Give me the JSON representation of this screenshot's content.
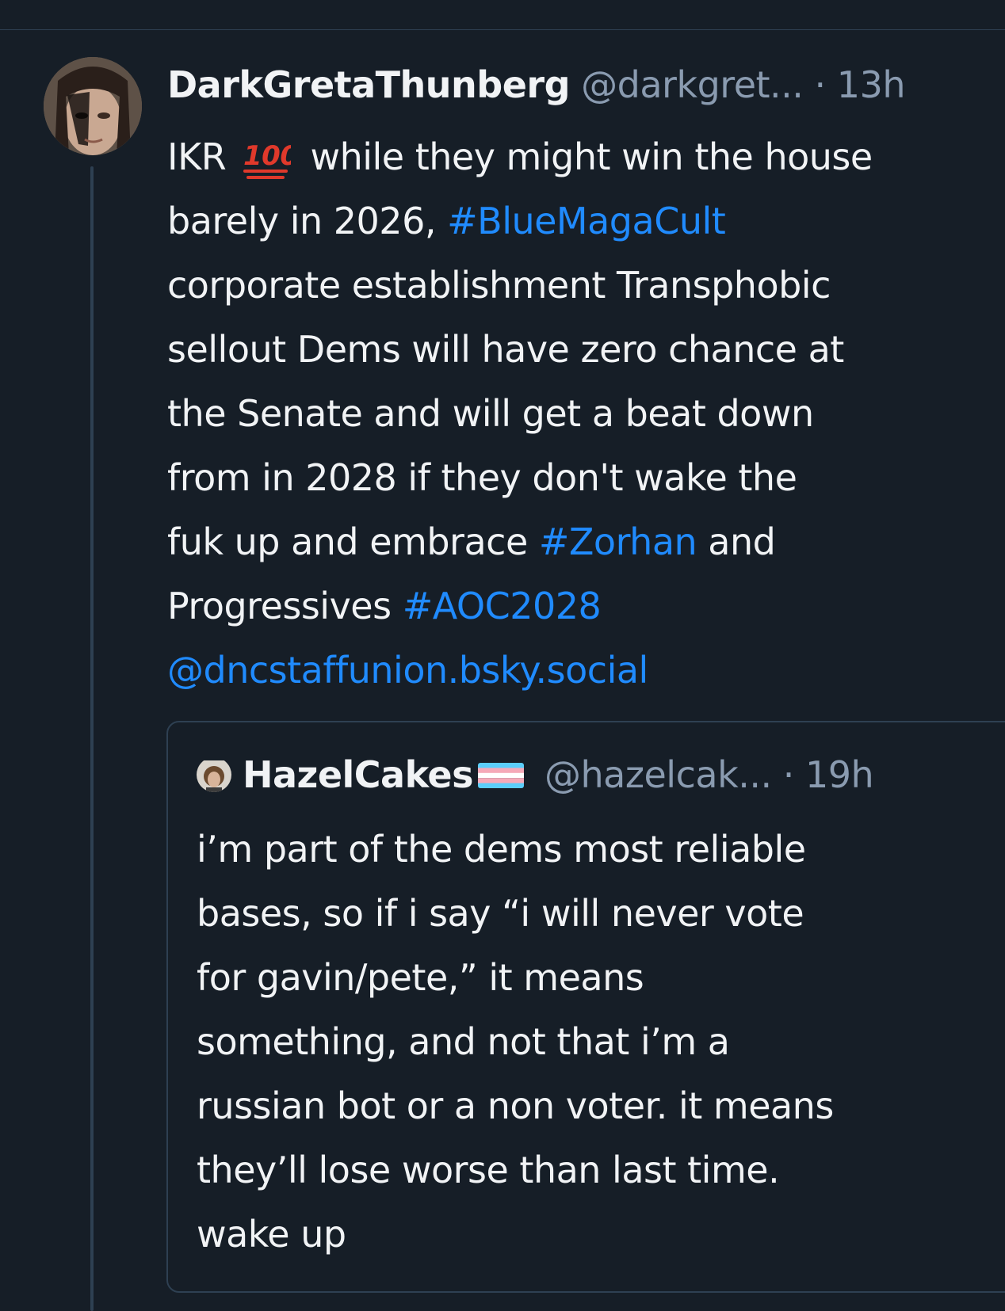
{
  "post": {
    "display_name": "DarkGretaThunberg",
    "handle": "@darkgret...",
    "separator": " · ",
    "timestamp": "13h",
    "avatar_icon": "user-avatar-photo",
    "emoji": "100-emoji",
    "body": {
      "l1a": "IKR",
      "l1b": "while they might win the house",
      "l2a": "barely in 2026, ",
      "l2b": "#BlueMagaCult",
      "l3": "corporate establishment Transphobic",
      "l4": "sellout Dems will have zero chance at",
      "l5": "the Senate and will get a beat down",
      "l6": "from in 2028 if they don't wake the",
      "l7a": "fuk up and embrace ",
      "l7b": "#Zorhan",
      "l7c": " and",
      "l8a": "Progressives ",
      "l8b": "#AOC2028",
      "l9": "@dncstaffunion.bsky.social"
    }
  },
  "quote": {
    "display_name": "HazelCakes",
    "flag_icon": "transgender-flag-emoji",
    "handle": "@hazelcak...",
    "separator": " · ",
    "timestamp": "19h",
    "body": {
      "l1": "i’m part of the dems most reliable",
      "l2": "bases, so if i say “i will never vote",
      "l3": "for gavin/pete,” it means",
      "l4": "something, and not that i’m a",
      "l5": "russian bot or a non voter. it means",
      "l6": "they’ll lose worse than last time.",
      "l7": "wake up"
    }
  },
  "colors": {
    "background": "#161e27",
    "divider": "#2e4052",
    "text": "#f1f3f5",
    "muted": "#8a9bb0",
    "link": "#208bfe"
  }
}
